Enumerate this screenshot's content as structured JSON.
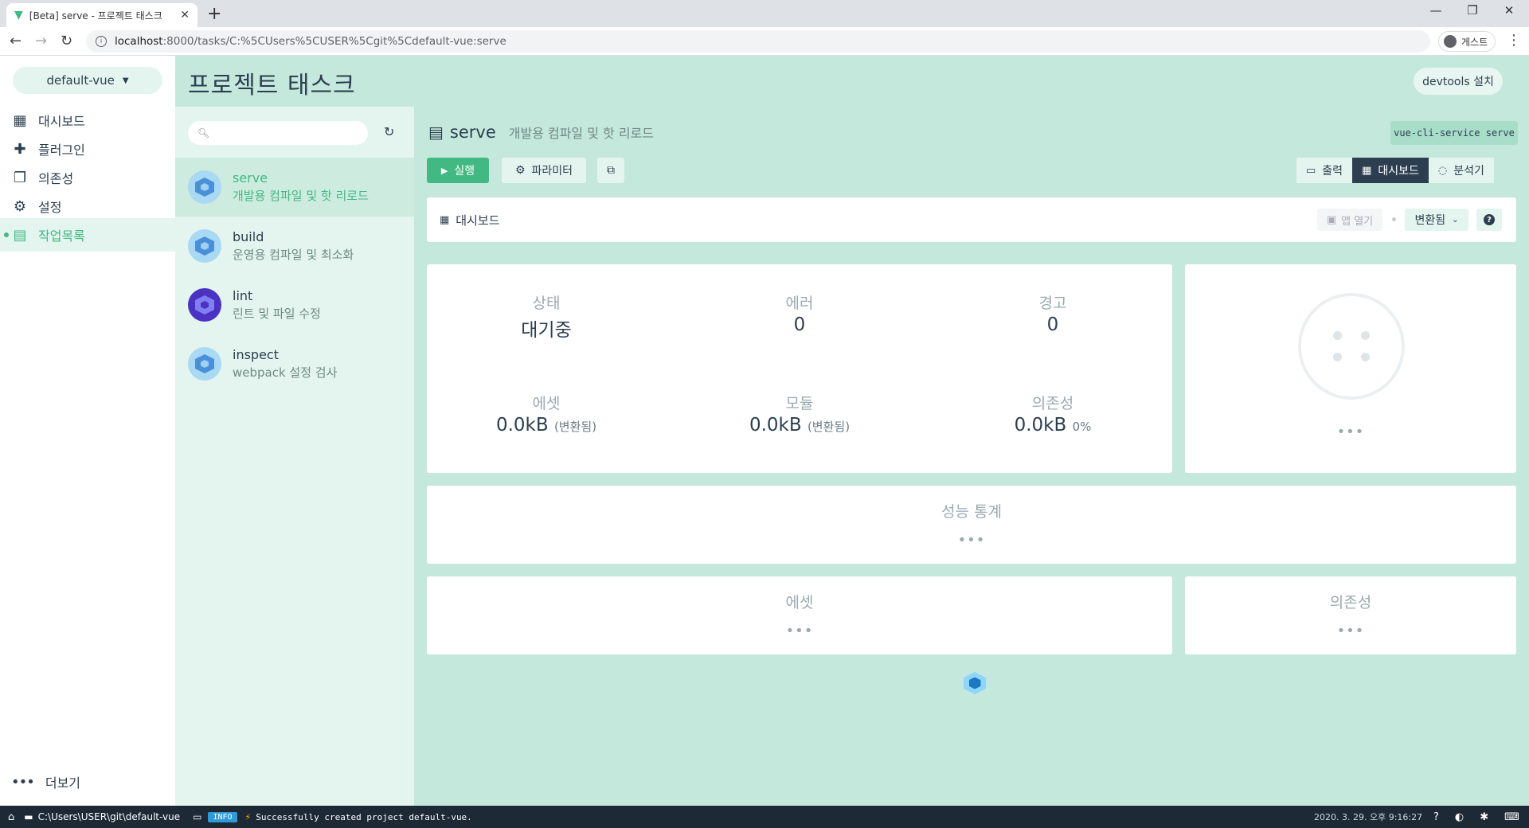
{
  "browser": {
    "tab_title": "[Beta] serve - 프로젝트 태스크",
    "url_host": "localhost",
    "url_path": ":8000/tasks/C:%5CUsers%5CUSER%5Cgit%5Cdefault-vue:serve",
    "profile_label": "게스트"
  },
  "sidebar": {
    "project": "default-vue",
    "items": [
      {
        "label": "대시보드",
        "icon": "dashboard-icon"
      },
      {
        "label": "플러그인",
        "icon": "puzzle-icon"
      },
      {
        "label": "의존성",
        "icon": "library-icon"
      },
      {
        "label": "설정",
        "icon": "settings-icon"
      },
      {
        "label": "작업목록",
        "icon": "clipboard-icon",
        "active": true
      }
    ],
    "more_label": "더보기"
  },
  "header": {
    "title": "프로젝트 태스크",
    "devtools_label": "devtools 설치"
  },
  "tasks": [
    {
      "name": "serve",
      "desc": "개발용 컴파일 및 핫 리로드",
      "selected": true
    },
    {
      "name": "build",
      "desc": "운영용 컴파일 및 최소화"
    },
    {
      "name": "lint",
      "desc": "린트 및 파일 수정"
    },
    {
      "name": "inspect",
      "desc": "webpack 설정 검사"
    }
  ],
  "task_detail": {
    "name": "serve",
    "desc": "개발용 컴파일 및 핫 리로드",
    "command": "vue-cli-service serve",
    "run_label": "실행",
    "params_label": "파라미터",
    "view_tabs": [
      {
        "label": "출력",
        "icon": "terminal-icon"
      },
      {
        "label": "대시보드",
        "icon": "dashboard-icon",
        "active": true
      },
      {
        "label": "분석기",
        "icon": "donut-icon"
      }
    ]
  },
  "dashboard": {
    "label": "대시보드",
    "open_app_label": "앱 열기",
    "mode_label": "변환됨",
    "stats": {
      "status_label": "상태",
      "status_value": "대기중",
      "errors_label": "에러",
      "errors_value": "0",
      "warnings_label": "경고",
      "warnings_value": "0",
      "assets_label": "에셋",
      "assets_value": "0.0kB",
      "assets_note": "(변환됨)",
      "modules_label": "모듈",
      "modules_value": "0.0kB",
      "modules_note": "(변환됨)",
      "deps_label": "의존성",
      "deps_value": "0.0kB",
      "deps_note": "0%"
    },
    "graph_ellipsis": "•••",
    "perf_title": "성능 통계",
    "perf_ellipsis": "•••",
    "assets_title": "에셋",
    "assets_ellipsis": "•••",
    "deps_title": "의존성",
    "deps_ellipsis": "•••"
  },
  "statusbar": {
    "path": "C:\\Users\\USER\\git\\default-vue",
    "level": "INFO",
    "message": "Successfully created project default-vue.",
    "time": "2020. 3. 29. 오후 9:16:27"
  },
  "colors": {
    "accent": "#42b983",
    "header_bg": "#c5e8dc",
    "tasklist_bg": "#e4f5ef",
    "statusbar_bg": "#1d2935"
  }
}
